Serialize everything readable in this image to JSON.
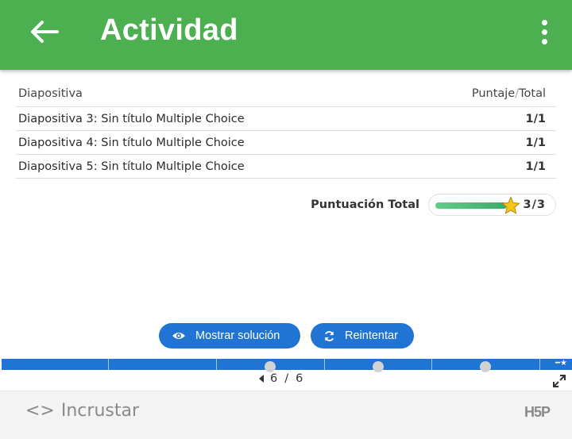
{
  "appbar": {
    "title": "Actividad",
    "back_icon": "arrow-left-icon",
    "menu_icon": "more-vert-icon"
  },
  "table": {
    "header": {
      "col1": "Diapositiva",
      "col2_a": "Puntaje",
      "col2_sep": "/",
      "col2_b": "Total"
    },
    "rows": [
      {
        "label": "Diapositiva 3: Sin título Multiple Choice",
        "score": "1/1"
      },
      {
        "label": "Diapositiva 4: Sin título Multiple Choice",
        "score": "1/1"
      },
      {
        "label": "Diapositiva 5: Sin título Multiple Choice",
        "score": "1/1"
      }
    ]
  },
  "total": {
    "label": "Puntuación Total",
    "value": "3/3",
    "fraction": 1.0
  },
  "buttons": {
    "show_solution": "Mostrar solución",
    "retry": "Reintentar"
  },
  "pager": {
    "current": "6",
    "sep": "/",
    "total": "6"
  },
  "footer": {
    "embed": "Incrustar",
    "brand": "H5P"
  },
  "colors": {
    "appbar": "#4caf50",
    "accent": "#1f74d4",
    "score_bar": "#3bab6b",
    "star": "#f5c518"
  }
}
